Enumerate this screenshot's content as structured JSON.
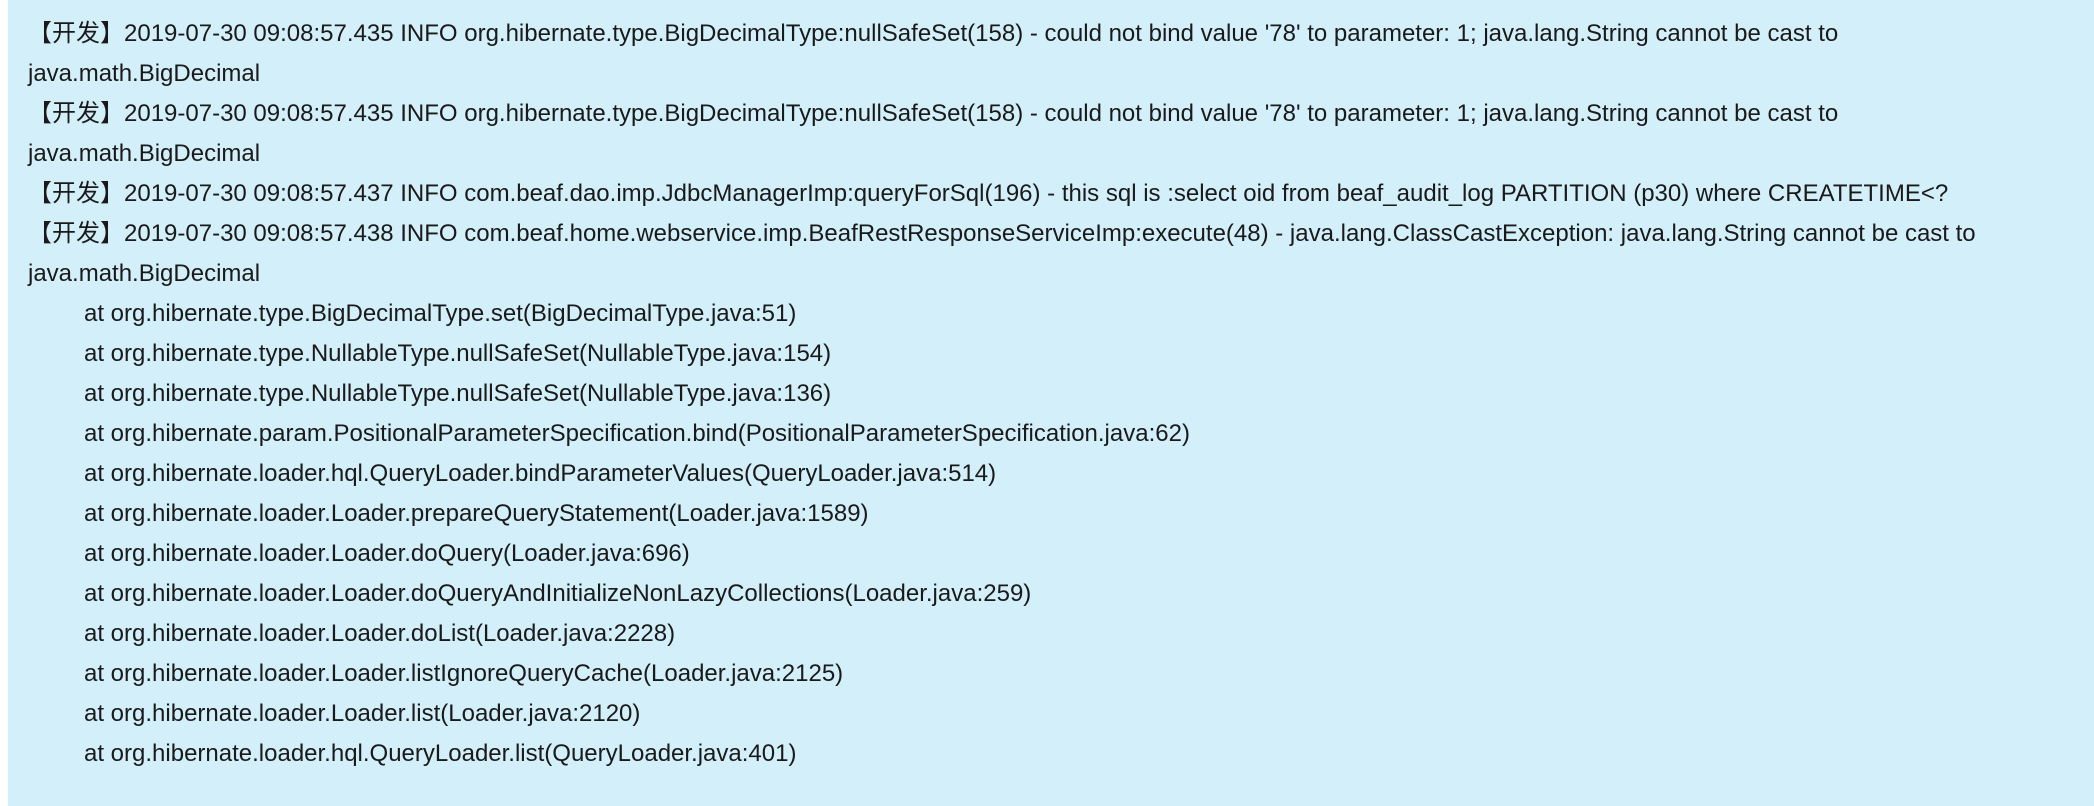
{
  "log": {
    "entries": [
      "【开发】2019-07-30 09:08:57.435  INFO org.hibernate.type.BigDecimalType:nullSafeSet(158) - could not bind value '78' to parameter: 1; java.lang.String cannot be cast to java.math.BigDecimal",
      "【开发】2019-07-30 09:08:57.435  INFO org.hibernate.type.BigDecimalType:nullSafeSet(158) - could not bind value '78' to parameter: 1; java.lang.String cannot be cast to java.math.BigDecimal",
      "【开发】2019-07-30 09:08:57.437  INFO com.beaf.dao.imp.JdbcManagerImp:queryForSql(196) -  this sql is :select oid from beaf_audit_log PARTITION (p30) where CREATETIME<?",
      "【开发】2019-07-30 09:08:57.438  INFO com.beaf.home.webservice.imp.BeafRestResponseServiceImp:execute(48) - java.lang.ClassCastException: java.lang.String cannot be cast to java.math.BigDecimal"
    ],
    "stack": [
      "at org.hibernate.type.BigDecimalType.set(BigDecimalType.java:51)",
      "at org.hibernate.type.NullableType.nullSafeSet(NullableType.java:154)",
      "at org.hibernate.type.NullableType.nullSafeSet(NullableType.java:136)",
      "at org.hibernate.param.PositionalParameterSpecification.bind(PositionalParameterSpecification.java:62)",
      "at org.hibernate.loader.hql.QueryLoader.bindParameterValues(QueryLoader.java:514)",
      "at org.hibernate.loader.Loader.prepareQueryStatement(Loader.java:1589)",
      "at org.hibernate.loader.Loader.doQuery(Loader.java:696)",
      "at org.hibernate.loader.Loader.doQueryAndInitializeNonLazyCollections(Loader.java:259)",
      "at org.hibernate.loader.Loader.doList(Loader.java:2228)",
      "at org.hibernate.loader.Loader.listIgnoreQueryCache(Loader.java:2125)",
      "at org.hibernate.loader.Loader.list(Loader.java:2120)",
      "at org.hibernate.loader.hql.QueryLoader.list(QueryLoader.java:401)"
    ]
  },
  "colors": {
    "panel_background": "#d2effa",
    "text": "#1a1a1a"
  }
}
